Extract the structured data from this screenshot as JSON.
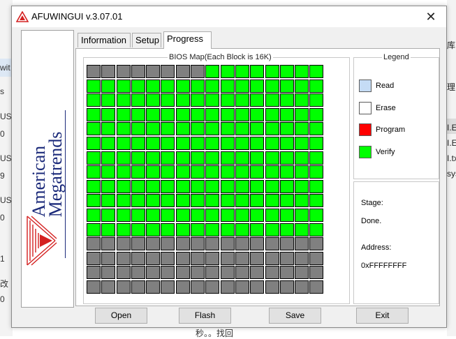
{
  "window": {
    "title": "AFUWINGUI v.3.07.01",
    "close_label": "✕"
  },
  "logo": {
    "line1": "American",
    "line2": "Megatrends",
    "brand_color": "#1b2a7a",
    "mark_color": "#d42020"
  },
  "tabs": [
    {
      "label": "Information",
      "active": false
    },
    {
      "label": "Setup",
      "active": false
    },
    {
      "label": "Progress",
      "active": true
    }
  ],
  "bios_map": {
    "title": "BIOS Map(Each Block is 16K)",
    "columns": 16,
    "rows": 16,
    "first_row_gray_cells": 8,
    "verified_rows_after_first": 11,
    "trailing_gray_rows": 4,
    "colors": {
      "gray": "#808080",
      "verify": "#00ff00"
    }
  },
  "legend": {
    "title": "Legend",
    "items": [
      {
        "label": "Read",
        "color": "#c5dcf5"
      },
      {
        "label": "Erase",
        "color": "#ffffff"
      },
      {
        "label": "Program",
        "color": "#ff0000"
      },
      {
        "label": "Verify",
        "color": "#00ff00"
      }
    ]
  },
  "status": {
    "stage_label": "Stage:",
    "stage_value": "Done.",
    "address_label": "Address:",
    "address_value": "0xFFFFFFFF"
  },
  "buttons": {
    "open": "Open",
    "flash": "Flash",
    "save": "Save",
    "exit": "Exit"
  },
  "background_app": {
    "left_fragments": [
      "wit",
      "s",
      "US",
      "0",
      "US-",
      "9",
      "US-",
      "0",
      "1",
      "改",
      "0"
    ],
    "right_fragments": [
      "库",
      "理",
      "I.E",
      "I.E",
      "I.tx",
      "sys"
    ],
    "bottom_fragment": "秒。。找回"
  }
}
